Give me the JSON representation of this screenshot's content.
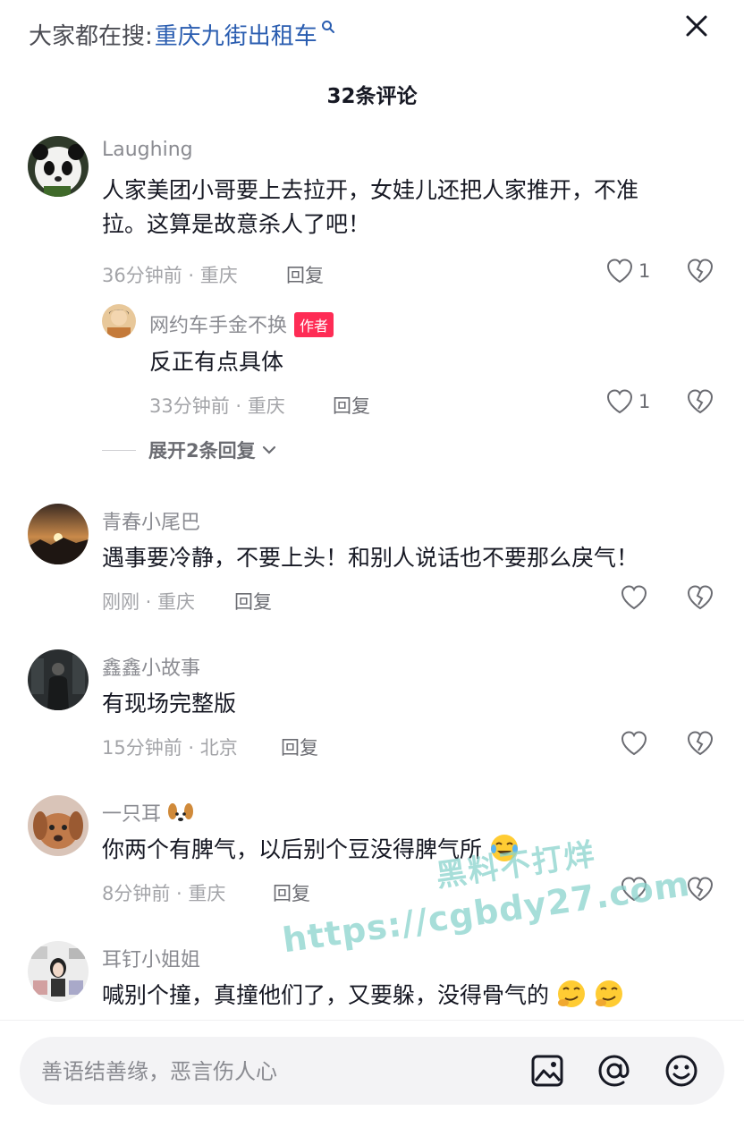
{
  "search": {
    "prefix": "大家都在搜:",
    "query": "重庆九街出租车"
  },
  "header": {
    "comment_count": "32条评论"
  },
  "comments": [
    {
      "username": "Laughing",
      "text_line1": "人家美团小哥要上去拉开，女娃儿还把人家推开，不准",
      "text_line2": "拉。这算是故意杀人了吧！",
      "meta": "36分钟前 · 重庆",
      "reply": "回复",
      "likes": "1",
      "avatar": "panda-avatar"
    },
    {
      "username": "网约车手金不换",
      "author_tag": "作者",
      "text": "反正有点具体",
      "meta": "33分钟前 · 重庆",
      "reply": "回复",
      "likes": "1",
      "avatar": "person-avatar"
    },
    {
      "username": "青春小尾巴",
      "text": "遇事要冷静，不要上头！和别人说话也不要那么戾气！",
      "meta": "刚刚 · 重庆",
      "reply": "回复",
      "avatar": "sunset-avatar"
    },
    {
      "username": "鑫鑫小故事",
      "text": "有现场完整版",
      "meta": "15分钟前 · 北京",
      "reply": "回复",
      "avatar": "dark-figure-avatar"
    },
    {
      "username": "一只耳",
      "text": "你两个有脾气，以后别个豆没得脾气所",
      "meta": "8分钟前 · 重庆",
      "reply": "回复",
      "avatar": "dog-avatar"
    },
    {
      "username": "耳钉小姐姐",
      "text": "喊别个撞，真撞他们了，又要躲，没得骨气的",
      "avatar": "collage-avatar"
    }
  ],
  "expand_replies": "展开2条回复",
  "input": {
    "placeholder": "善语结善缘，恶言伤人心"
  },
  "watermark": {
    "line1": "黑料不打烊",
    "line2": "https://cgbdy27.com"
  },
  "colors": {
    "accent_red": "#fe2c55",
    "link_blue": "#2a5db0",
    "watermark": "#8ad3cd"
  }
}
